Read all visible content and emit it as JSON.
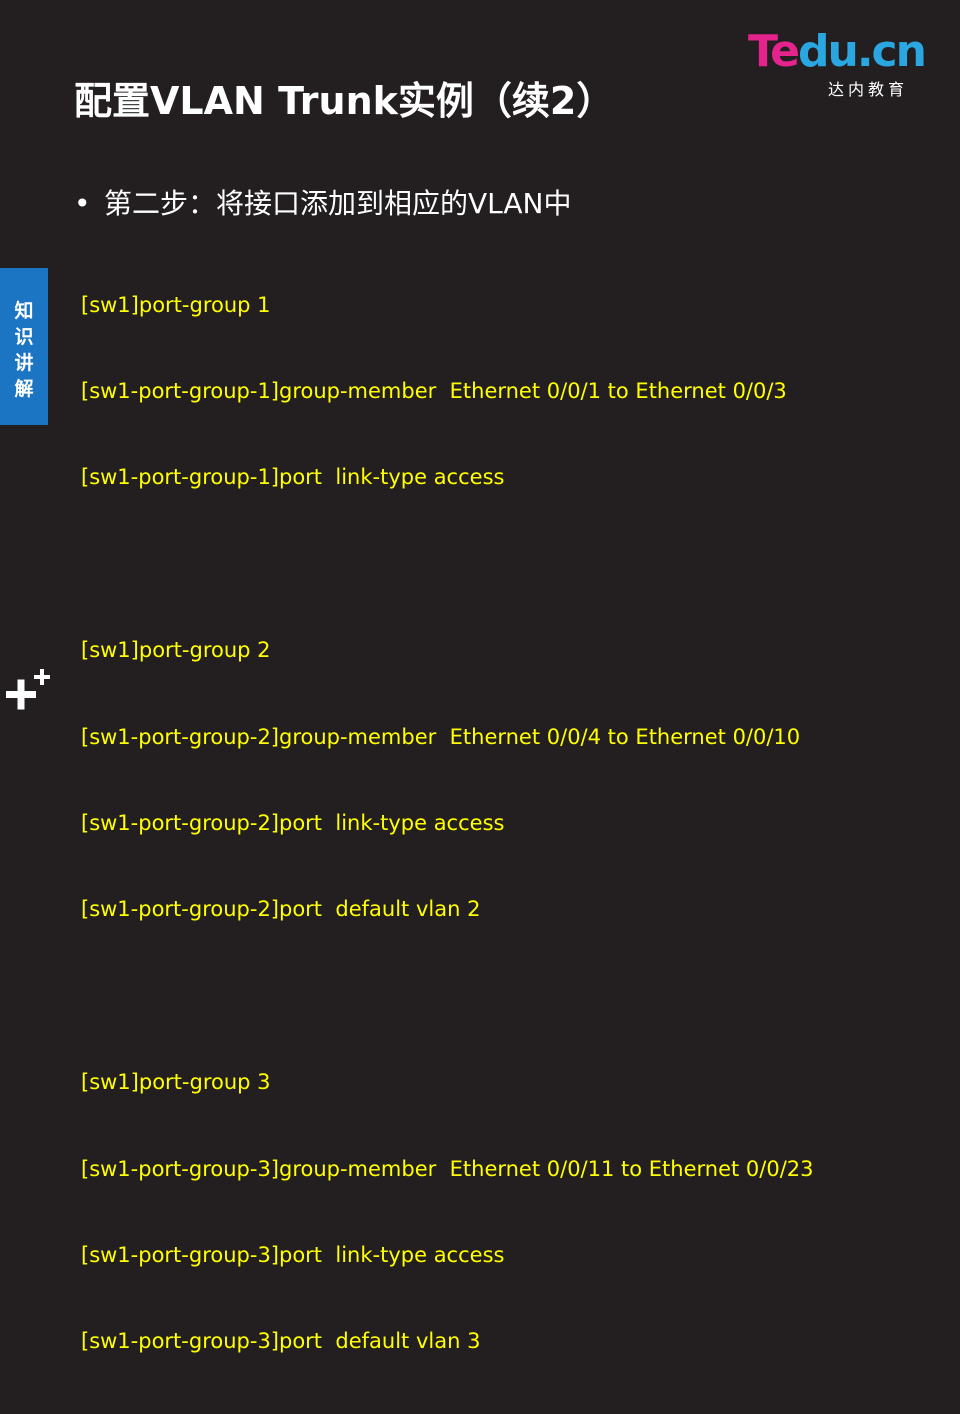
{
  "slide": {
    "title": "配置VLAN Trunk实例（续2）",
    "logo": {
      "brand_part1": "Te",
      "brand_part2": "du.cn",
      "subtitle": "达内教育",
      "colors": {
        "pink": "#e4238c",
        "blue": "#2aa7e0"
      }
    },
    "bullet": {
      "marker": "•",
      "text": "第二步：将接口添加到相应的VLAN中"
    },
    "code_lines": [
      "[sw1]port-group 1",
      "[sw1-port-group-1]group-member  Ethernet 0/0/1 to Ethernet 0/0/3",
      "[sw1-port-group-1]port  link-type access",
      "",
      "[sw1]port-group 2",
      "[sw1-port-group-2]group-member  Ethernet 0/0/4 to Ethernet 0/0/10",
      "[sw1-port-group-2]port  link-type access",
      "[sw1-port-group-2]port  default vlan 2",
      "",
      "[sw1]port-group 3",
      "[sw1-port-group-3]group-member  Ethernet 0/0/11 to Ethernet 0/0/23",
      "[sw1-port-group-3]port  link-type access",
      "[sw1-port-group-3]port  default vlan 3"
    ],
    "side_tab": {
      "chars": [
        "知",
        "识",
        "讲",
        "解"
      ],
      "color": "#1b75c2"
    },
    "icons": {
      "corner": "plus-icon"
    },
    "colors": {
      "background": "#231f20",
      "code": "#ffff00",
      "text": "#ffffff"
    }
  }
}
